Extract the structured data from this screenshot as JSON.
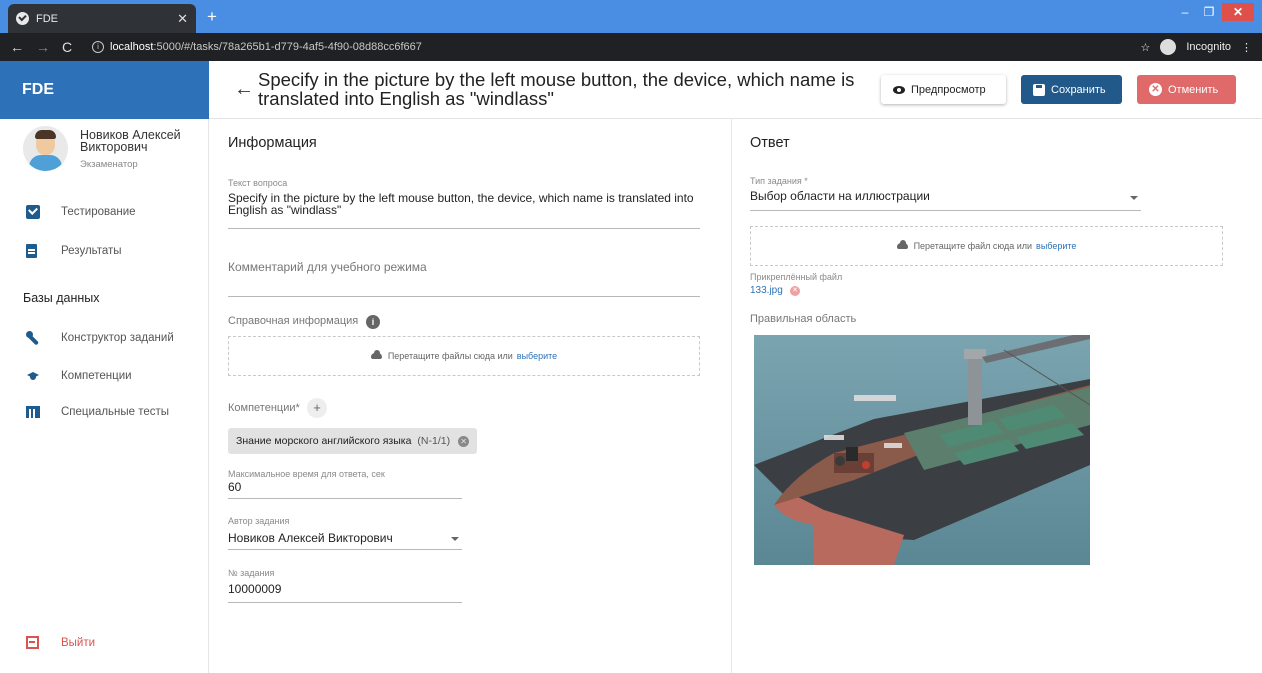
{
  "browser": {
    "tab_title": "FDE",
    "url_host": "localhost",
    "url_rest": ":5000/#/tasks/78a265b1-d779-4af5-4f90-08d88cc6f667",
    "incognito_label": "Incognito"
  },
  "app": {
    "brand": "FDE",
    "page_title": "Specify in the picture by the left mouse button, the device, which name is translated into English as \"windlass\"",
    "buttons": {
      "preview": "Предпросмотр",
      "save": "Сохранить",
      "cancel": "Отменить"
    }
  },
  "sidebar": {
    "user_name": "Новиков Алексей Викторович",
    "user_role": "Экзаменатор",
    "items": [
      {
        "label": "Тестирование"
      },
      {
        "label": "Результаты"
      }
    ],
    "db_section": "Базы данных",
    "db_items": [
      {
        "label": "Конструктор заданий"
      },
      {
        "label": "Компетенции"
      },
      {
        "label": "Специальные тесты"
      }
    ],
    "logout": "Выйти"
  },
  "info": {
    "title": "Информация",
    "question_label": "Текст вопроса",
    "question_text": "Specify in the picture by the left mouse button, the device, which name is translated into English as \"windlass\"",
    "comment_placeholder": "Комментарий для учебного режима",
    "reference_label": "Справочная информация",
    "reference_drop_text": "Перетащите файлы сюда или",
    "reference_drop_link": "выберите",
    "competence_label": "Компетенции*",
    "competence_chip": "Знание морского английского языка",
    "competence_code": "(N-1/1)",
    "max_time_label": "Максимальное время для ответа, сек",
    "max_time_value": "60",
    "author_label": "Автор задания",
    "author_value": "Новиков Алексей Викторович",
    "task_no_label": "№ задания",
    "task_no_value": "10000009"
  },
  "answer": {
    "title": "Ответ",
    "type_label": "Тип задания *",
    "type_value": "Выбор области на иллюстрации",
    "drop_text": "Перетащите файл сюда или",
    "drop_link": "выберите",
    "attached_label": "Прикреплённый файл",
    "attached_file": "133.jpg",
    "area_label": "Правильная область"
  }
}
